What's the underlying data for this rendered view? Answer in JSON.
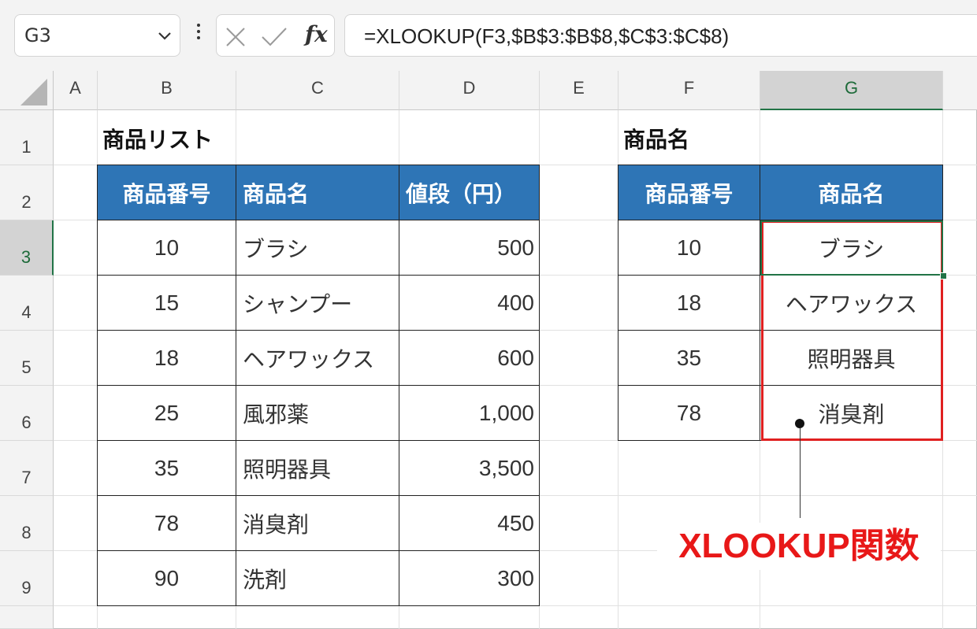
{
  "formula_bar": {
    "name_box": "G3",
    "formula": "=XLOOKUP(F3,$B$3:$B$8,$C$3:$C$8)",
    "fx_label": "fx"
  },
  "columns": [
    "A",
    "B",
    "C",
    "D",
    "E",
    "F",
    "G"
  ],
  "rows": [
    "1",
    "2",
    "3",
    "4",
    "5",
    "6",
    "7",
    "8",
    "9"
  ],
  "product_list": {
    "title": "商品リスト",
    "headers": [
      "商品番号",
      "商品名",
      "値段（円）"
    ],
    "rows": [
      [
        "10",
        "ブラシ",
        "500"
      ],
      [
        "15",
        "シャンプー",
        "400"
      ],
      [
        "18",
        "ヘアワックス",
        "600"
      ],
      [
        "25",
        "風邪薬",
        "1,000"
      ],
      [
        "35",
        "照明器具",
        "3,500"
      ],
      [
        "78",
        "消臭剤",
        "450"
      ],
      [
        "90",
        "洗剤",
        "300"
      ]
    ]
  },
  "lookup_table": {
    "title": "商品名",
    "headers": [
      "商品番号",
      "商品名"
    ],
    "rows": [
      [
        "10",
        "ブラシ"
      ],
      [
        "18",
        "ヘアワックス"
      ],
      [
        "35",
        "照明器具"
      ],
      [
        "78",
        "消臭剤"
      ]
    ]
  },
  "callout": "XLOOKUP関数",
  "colors": {
    "header_fill": "#2e75b6",
    "highlight": "#e02020",
    "selection": "#217346"
  }
}
